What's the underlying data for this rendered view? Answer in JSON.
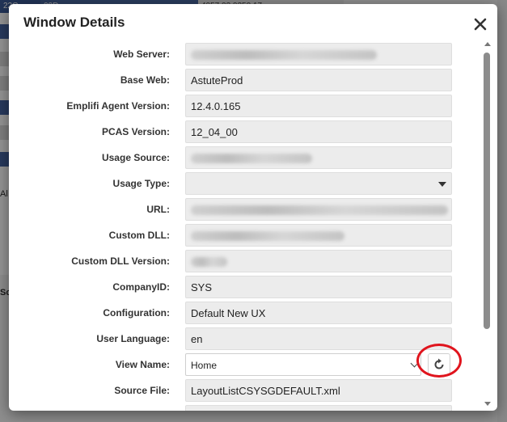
{
  "background": {
    "top_cells": [
      "22C",
      "00D",
      "4057 02 0250 17"
    ],
    "left_text_1": "Al",
    "left_text_2": "Sc"
  },
  "modal": {
    "title": "Window Details",
    "close_symbol": "✕",
    "fields": [
      {
        "label": "Web Server:",
        "value": "",
        "blurred": true
      },
      {
        "label": "Base Web:",
        "value": "AstuteProd"
      },
      {
        "label": "Emplifi Agent Version:",
        "value": "12.4.0.165"
      },
      {
        "label": "PCAS Version:",
        "value": "12_04_00"
      },
      {
        "label": "Usage Source:",
        "value": "",
        "blurred": true
      },
      {
        "label": "Usage Type:",
        "value": ""
      },
      {
        "label": "URL:",
        "value": "",
        "blurred": true
      },
      {
        "label": "Custom DLL:",
        "value": "",
        "blurred": true
      },
      {
        "label": "Custom DLL Version:",
        "value": "",
        "blurred": true
      },
      {
        "label": "CompanyID:",
        "value": "SYS"
      },
      {
        "label": "Configuration:",
        "value": "Default New UX"
      },
      {
        "label": "User Language:",
        "value": "en"
      },
      {
        "label": "View Name:",
        "value": "Home"
      },
      {
        "label": "Source File:",
        "value": "LayoutListCSYSGDEFAULT.xml"
      }
    ]
  },
  "colors": {
    "highlight_ring": "#e0141d",
    "field_bg": "#ececec",
    "accent_stripe": "#3a5a9c"
  },
  "icons": {
    "close": "close-icon",
    "refresh": "refresh-icon",
    "dropdown": "caret-down-icon",
    "chevron": "chevron-down-icon"
  }
}
